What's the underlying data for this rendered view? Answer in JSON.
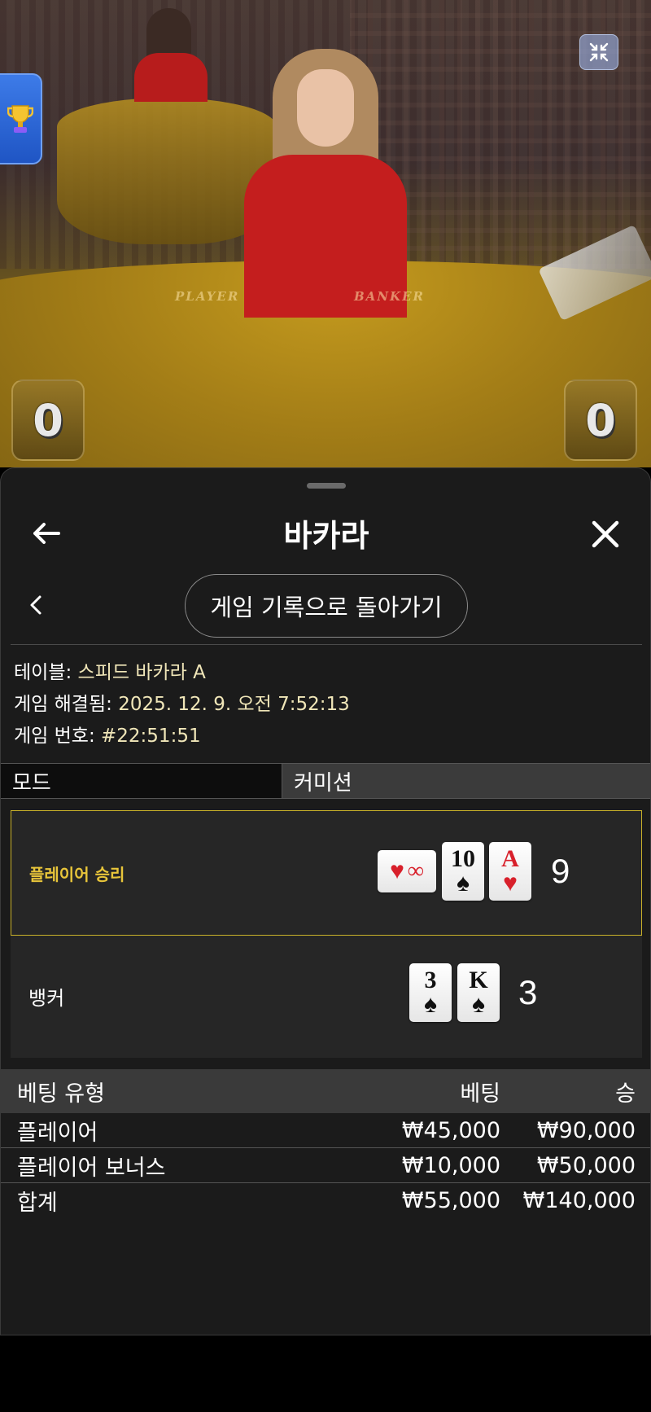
{
  "video": {
    "felt_player_label": "PLAYER",
    "felt_banker_label": "BANKER",
    "player_score": "0",
    "banker_score": "0"
  },
  "sheet": {
    "title": "바카라",
    "history_button_label": "게임 기록으로 돌아가기",
    "info": {
      "table_label": "테이블:",
      "table_value": "스피드 바카라 A",
      "resolved_label": "게임 해결됨:",
      "resolved_value": "2025. 12. 9. 오전 7:52:13",
      "game_no_label": "게임 번호:",
      "game_no_value": "#22:51:51"
    },
    "tabs": [
      {
        "label": "모드",
        "active": true
      },
      {
        "label": "커미션",
        "active": false
      }
    ],
    "results": [
      {
        "label": "플레이어 승리",
        "winner": true,
        "cards": [
          {
            "rank": "∞",
            "suit": "♥",
            "color": "red",
            "sideways": true
          },
          {
            "rank": "10",
            "suit": "♠",
            "color": "black"
          },
          {
            "rank": "A",
            "suit": "♥",
            "color": "red"
          }
        ],
        "total": "9"
      },
      {
        "label": "뱅커",
        "winner": false,
        "cards": [
          {
            "rank": "3",
            "suit": "♠",
            "color": "black"
          },
          {
            "rank": "K",
            "suit": "♠",
            "color": "black"
          }
        ],
        "total": "3"
      }
    ],
    "bets": {
      "headers": {
        "type": "베팅 유형",
        "bet": "베팅",
        "win": "승"
      },
      "rows": [
        {
          "type": "플레이어",
          "bet": "₩45,000",
          "win": "₩90,000"
        },
        {
          "type": "플레이어 보너스",
          "bet": "₩10,000",
          "win": "₩50,000"
        },
        {
          "type": "합계",
          "bet": "₩55,000",
          "win": "₩140,000"
        }
      ]
    }
  },
  "colors": {
    "sheet_bg": "#1b1b1b",
    "winner_accent": "#e8c53a",
    "info_value": "#f0e6b8",
    "red_suit": "#d8202b",
    "trophy_tab": "#2f6ad8"
  },
  "icons": {
    "collapse": "collapse-icon",
    "trophy": "trophy-icon",
    "back": "arrow-left-icon",
    "close": "close-icon",
    "prev": "chevron-left-icon"
  }
}
